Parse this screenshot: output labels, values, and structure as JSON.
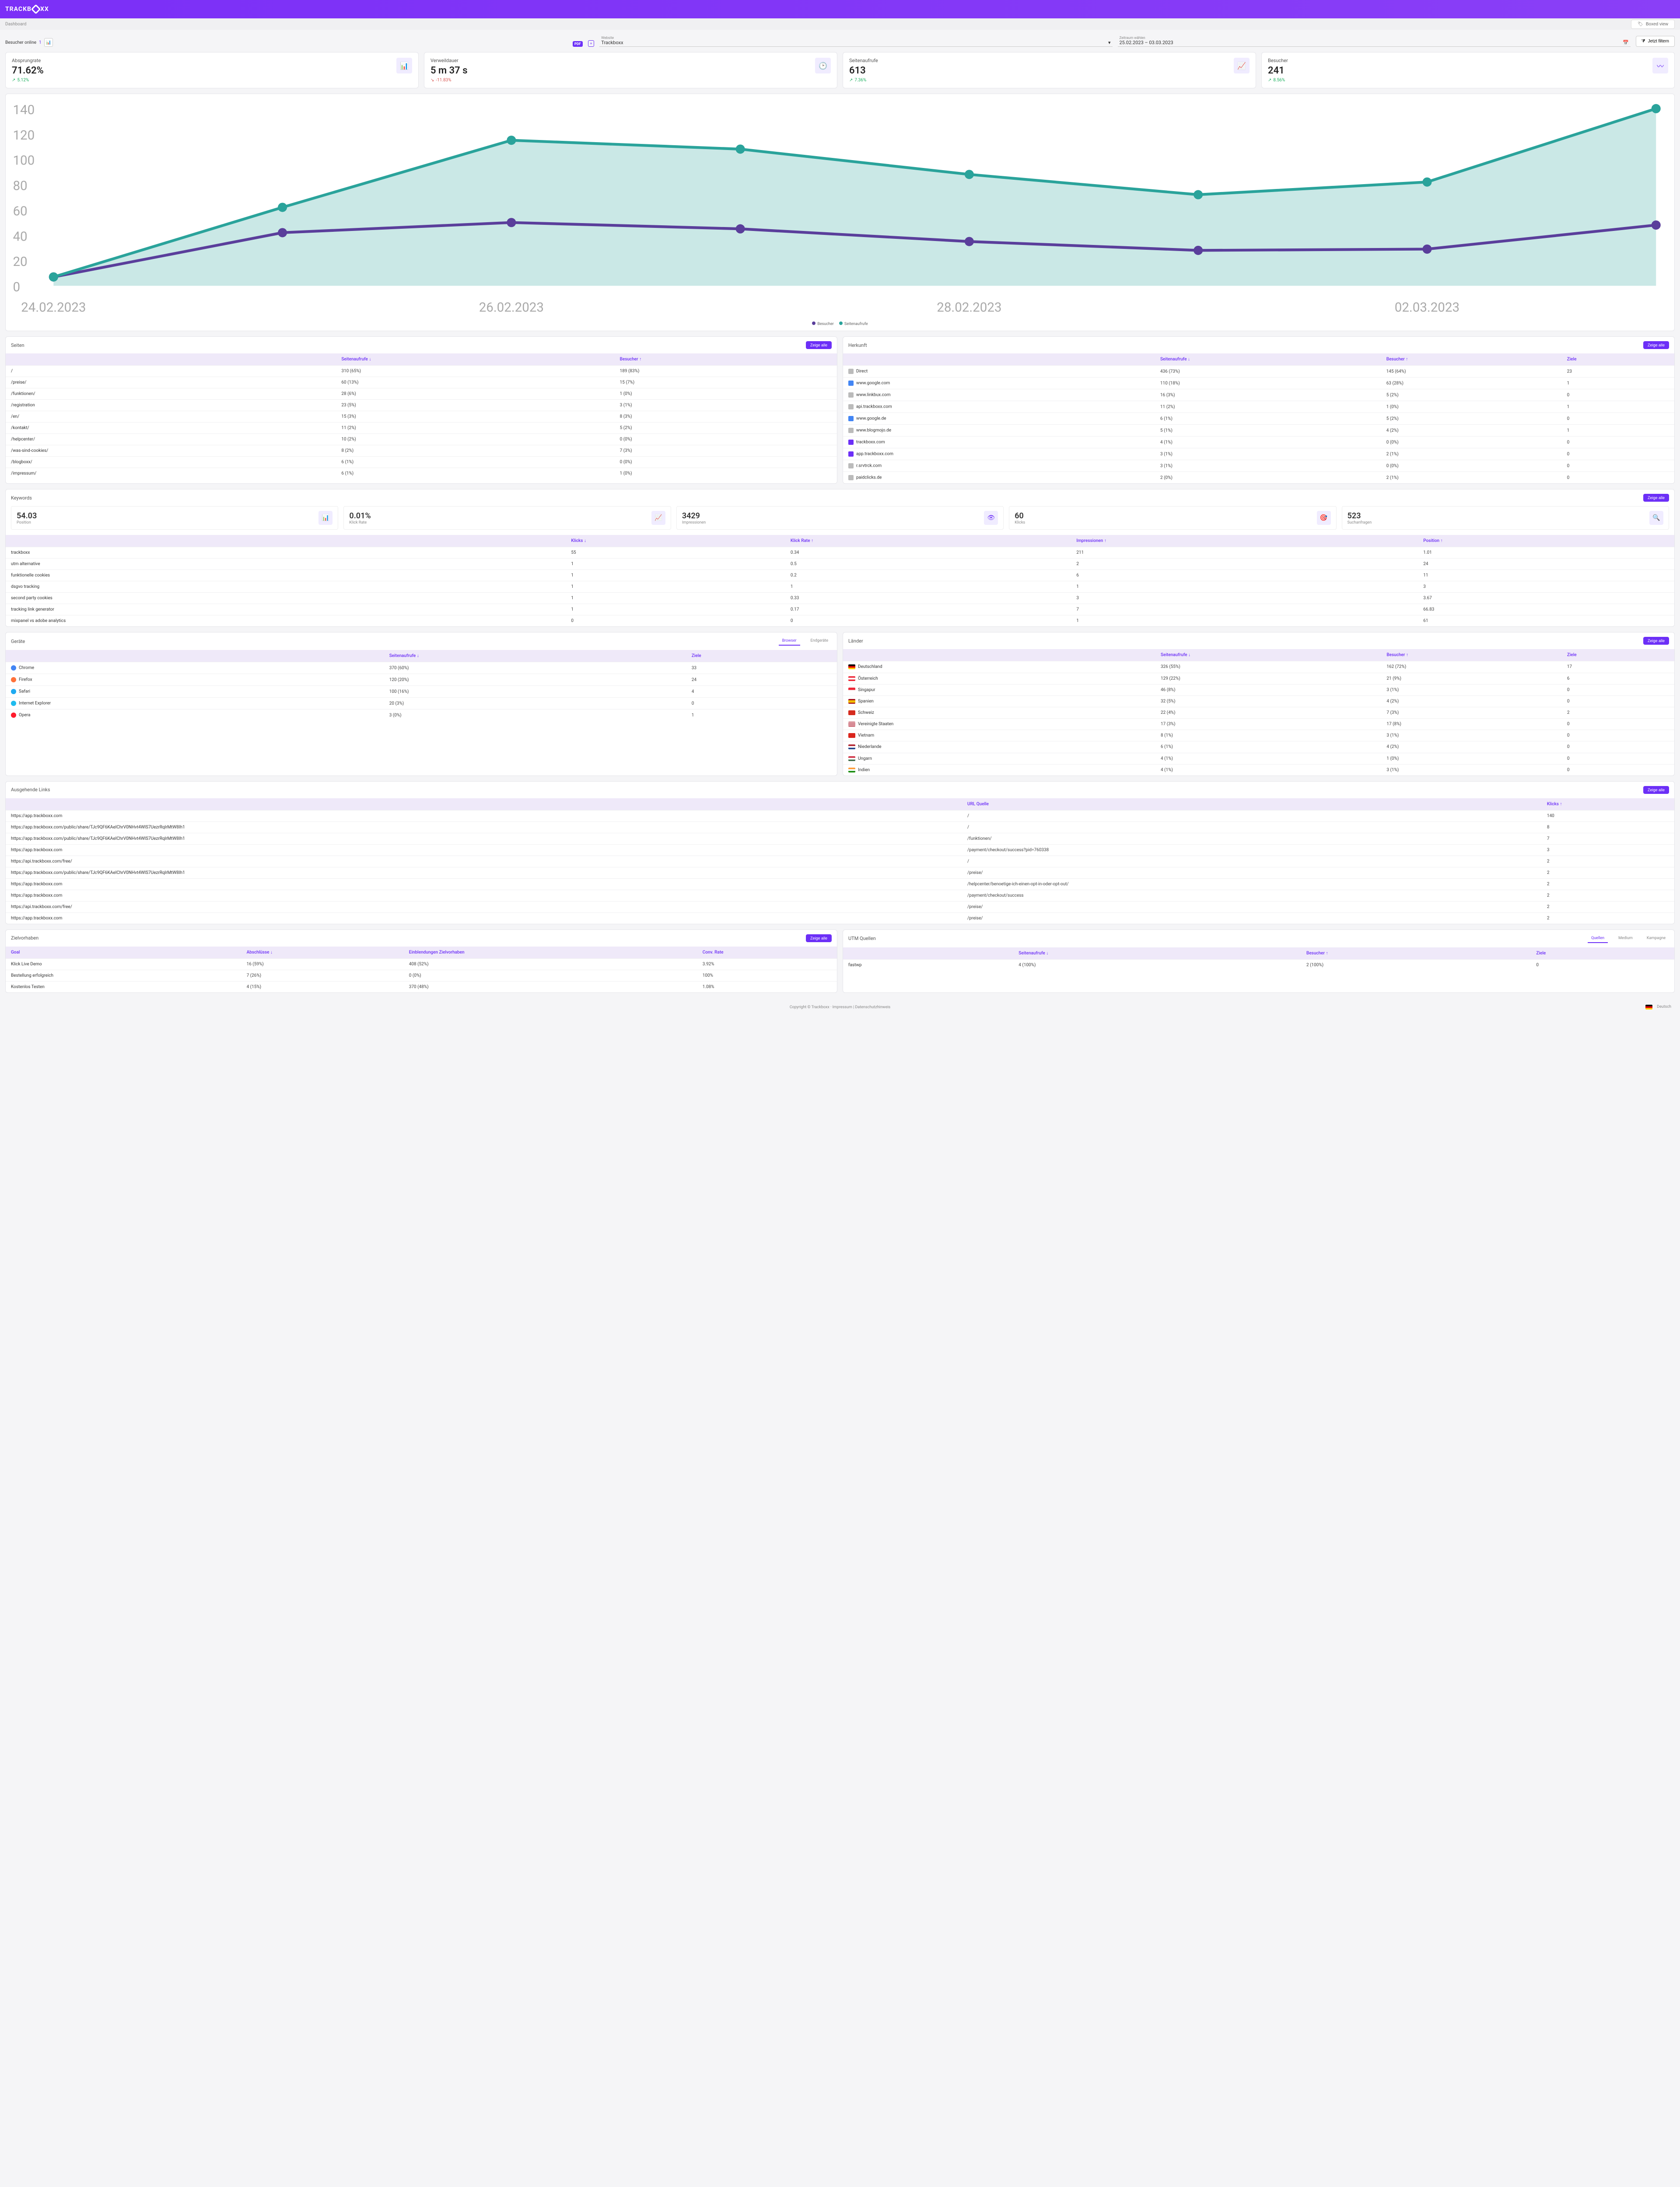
{
  "logo": "TRACKB  XX",
  "breadcrumb": "Dashboard",
  "boxed_view": "Boxed view",
  "visitors_online_label": "Besucher online",
  "visitors_online_value": "1",
  "website_label": "Website",
  "website_value": "Trackboxx",
  "period_label": "Zeitraum wählen",
  "period_value": "25.02.2023 – 03.03.2023",
  "filter_btn": "Jetzt filtern",
  "kpis": [
    {
      "title": "Absprungrate",
      "value": "71.62%",
      "delta": "5.12%",
      "dir": "up",
      "icon": "bar"
    },
    {
      "title": "Verweildauer",
      "value": "5 m 37 s",
      "delta": "-11.83%",
      "dir": "down",
      "icon": "clock"
    },
    {
      "title": "Seitenaufrufe",
      "value": "613",
      "delta": "7.36%",
      "dir": "up",
      "icon": "trend"
    },
    {
      "title": "Besucher",
      "value": "241",
      "delta": "8.56%",
      "dir": "up",
      "icon": "pulse"
    }
  ],
  "chart_data": {
    "type": "area",
    "x": [
      "24.02.2023",
      "25.02.2023",
      "26.02.2023",
      "27.02.2023",
      "28.02.2023",
      "01.03.2023",
      "02.03.2023",
      "03.03.2023"
    ],
    "ylim": [
      0,
      140
    ],
    "yticks": [
      0,
      20,
      40,
      60,
      80,
      100,
      120,
      140
    ],
    "series": [
      {
        "name": "Besucher",
        "color": "#5a3e9b",
        "values": [
          7,
          42,
          50,
          45,
          35,
          28,
          29,
          48
        ]
      },
      {
        "name": "Seitenaufrufe",
        "color": "#2aa39b",
        "values": [
          7,
          62,
          115,
          108,
          88,
          72,
          82,
          140
        ]
      }
    ],
    "x_visible_ticks": [
      "24.02.2023",
      "26.02.2023",
      "28.02.2023",
      "02.03.2023"
    ]
  },
  "show_all": "Zeige alle",
  "pages": {
    "title": "Seiten",
    "cols": [
      "",
      "Seitenaufrufe ↓",
      "Besucher ↑"
    ],
    "rows": [
      [
        "/",
        "310 (65%)",
        "189 (83%)"
      ],
      [
        "/preise/",
        "60 (13%)",
        "15 (7%)"
      ],
      [
        "/funktionen/",
        "28 (6%)",
        "1 (0%)"
      ],
      [
        "/registration",
        "23 (5%)",
        "3 (1%)"
      ],
      [
        "/en/",
        "15 (3%)",
        "8 (3%)"
      ],
      [
        "/kontakt/",
        "11 (2%)",
        "5 (2%)"
      ],
      [
        "/helpcenter/",
        "10 (2%)",
        "0 (0%)"
      ],
      [
        "/was-sind-cookies/",
        "8 (2%)",
        "7 (3%)"
      ],
      [
        "/blogboxx/",
        "6 (1%)",
        "0 (0%)"
      ],
      [
        "/impressum/",
        "6 (1%)",
        "1 (0%)"
      ]
    ]
  },
  "origin": {
    "title": "Herkunft",
    "cols": [
      "",
      "Seitenaufrufe ↓",
      "Besucher ↑",
      "Ziele"
    ],
    "rows": [
      {
        "icon": "link",
        "label": "Direct",
        "v": [
          "436 (73%)",
          "145 (64%)",
          "23"
        ]
      },
      {
        "icon": "google",
        "label": "www.google.com",
        "v": [
          "110 (18%)",
          "63 (28%)",
          "1"
        ]
      },
      {
        "icon": "link",
        "label": "www.linkbux.com",
        "v": [
          "16 (3%)",
          "5 (2%)",
          "0"
        ]
      },
      {
        "icon": "link",
        "label": "api.trackboxx.com",
        "v": [
          "11 (2%)",
          "1 (0%)",
          "1"
        ]
      },
      {
        "icon": "google",
        "label": "www.google.de",
        "v": [
          "6 (1%)",
          "5 (2%)",
          "0"
        ]
      },
      {
        "icon": "link",
        "label": "www.blogmojo.de",
        "v": [
          "5 (1%)",
          "4 (2%)",
          "1"
        ]
      },
      {
        "icon": "tb",
        "label": "trackboxx.com",
        "v": [
          "4 (1%)",
          "0 (0%)",
          "0"
        ]
      },
      {
        "icon": "tb",
        "label": "app.trackboxx.com",
        "v": [
          "3 (1%)",
          "2 (1%)",
          "0"
        ]
      },
      {
        "icon": "link",
        "label": "r.srvtrck.com",
        "v": [
          "3 (1%)",
          "0 (0%)",
          "0"
        ]
      },
      {
        "icon": "link",
        "label": "paidclicks.de",
        "v": [
          "2 (0%)",
          "2 (1%)",
          "0"
        ]
      }
    ]
  },
  "keywords": {
    "title": "Keywords",
    "stats": [
      {
        "value": "54.03",
        "label": "Position",
        "icon": "bars"
      },
      {
        "value": "0.01%",
        "label": "Klick Rate",
        "icon": "trend"
      },
      {
        "value": "3429",
        "label": "Impressionen",
        "icon": "eye"
      },
      {
        "value": "60",
        "label": "Klicks",
        "icon": "target"
      },
      {
        "value": "523",
        "label": "Suchanfragen",
        "icon": "search"
      }
    ],
    "cols": [
      "",
      "Klicks ↓",
      "Klick Rate ↑",
      "Impressionen ↑",
      "Position ↑"
    ],
    "rows": [
      [
        "trackboxx",
        "55",
        "0.34",
        "211",
        "1.01"
      ],
      [
        "utm alternative",
        "1",
        "0.5",
        "2",
        "24"
      ],
      [
        "funktionelle cookies",
        "1",
        "0.2",
        "6",
        "11"
      ],
      [
        "dsgvo tracking",
        "1",
        "1",
        "1",
        "3"
      ],
      [
        "second party cookies",
        "1",
        "0.33",
        "3",
        "3.67"
      ],
      [
        "tracking link generator",
        "1",
        "0.17",
        "7",
        "66.83"
      ],
      [
        "mixpanel vs adobe analytics",
        "0",
        "0",
        "1",
        "61"
      ]
    ]
  },
  "devices": {
    "title": "Geräte",
    "tabs": [
      "Browser",
      "Endgeräte"
    ],
    "cols": [
      "",
      "Seitenaufrufe ↓",
      "Ziele"
    ],
    "rows": [
      {
        "icon": "chrome",
        "label": "Chrome",
        "v": [
          "370 (60%)",
          "33"
        ]
      },
      {
        "icon": "firefox",
        "label": "Firefox",
        "v": [
          "120 (20%)",
          "24"
        ]
      },
      {
        "icon": "safari",
        "label": "Safari",
        "v": [
          "100 (16%)",
          "4"
        ]
      },
      {
        "icon": "ie",
        "label": "Internet Explorer",
        "v": [
          "20 (3%)",
          "0"
        ]
      },
      {
        "icon": "opera",
        "label": "Opera",
        "v": [
          "3 (0%)",
          "1"
        ]
      }
    ]
  },
  "countries": {
    "title": "Länder",
    "cols": [
      "",
      "Seitenaufrufe ↓",
      "Besucher ↑",
      "Ziele"
    ],
    "rows": [
      {
        "flag": "de",
        "label": "Deutschland",
        "v": [
          "326 (55%)",
          "162 (72%)",
          "17"
        ]
      },
      {
        "flag": "at",
        "label": "Österreich",
        "v": [
          "129 (22%)",
          "21 (9%)",
          "6"
        ]
      },
      {
        "flag": "sg",
        "label": "Singapur",
        "v": [
          "46 (8%)",
          "3 (1%)",
          "0"
        ]
      },
      {
        "flag": "es",
        "label": "Spanien",
        "v": [
          "32 (5%)",
          "4 (2%)",
          "0"
        ]
      },
      {
        "flag": "ch",
        "label": "Schweiz",
        "v": [
          "22 (4%)",
          "7 (3%)",
          "2"
        ]
      },
      {
        "flag": "us",
        "label": "Vereinigte Staaten",
        "v": [
          "17 (3%)",
          "17 (8%)",
          "0"
        ]
      },
      {
        "flag": "vn",
        "label": "Vietnam",
        "v": [
          "8 (1%)",
          "3 (1%)",
          "0"
        ]
      },
      {
        "flag": "nl",
        "label": "Niederlande",
        "v": [
          "6 (1%)",
          "4 (2%)",
          "0"
        ]
      },
      {
        "flag": "hu",
        "label": "Ungarn",
        "v": [
          "4 (1%)",
          "1 (0%)",
          "0"
        ]
      },
      {
        "flag": "in",
        "label": "Indien",
        "v": [
          "4 (1%)",
          "3 (1%)",
          "0"
        ]
      }
    ]
  },
  "outgoing": {
    "title": "Ausgehende Links",
    "cols": [
      "",
      "URL Quelle",
      "Klicks ↑"
    ],
    "rows": [
      [
        "https://app.trackboxx.com",
        "/",
        "140"
      ],
      [
        "https://app.trackboxx.com/public/share/TJc9QF6KAeIChrV0NHvt4WlS7UezrRqlrMtW8Ih1",
        "/",
        "8"
      ],
      [
        "https://app.trackboxx.com/public/share/TJc9QF6KAeIChrV0NHvt4WlS7UezrRqlrMtW8Ih1",
        "/funktionen/",
        "7"
      ],
      [
        "https://app.trackboxx.com",
        "/payment/checkout/success?pid=760338",
        "3"
      ],
      [
        "https://api.trackboxx.com/free/",
        "/",
        "2"
      ],
      [
        "https://app.trackboxx.com/public/share/TJc9QF6KAeIChrV0NHvt4WlS7UezrRqlrMtW8Ih1",
        "/preise/",
        "2"
      ],
      [
        "https://app.trackboxx.com",
        "/helpcenter/benoetige-ich-einen-opt-in-oder-opt-out/",
        "2"
      ],
      [
        "https://app.trackboxx.com",
        "/payment/checkout/success",
        "2"
      ],
      [
        "https://api.trackboxx.com/free/",
        "/preise/",
        "2"
      ],
      [
        "https://app.trackboxx.com",
        "/preise/",
        "2"
      ]
    ]
  },
  "goals": {
    "title": "Zielvorhaben",
    "cols": [
      "Goal",
      "Abschlüsse ↓",
      "Einblendungen Zielvorhaben",
      "Conv. Rate"
    ],
    "rows": [
      [
        "Klick Live Demo",
        "16 (59%)",
        "408 (52%)",
        "3.92%"
      ],
      [
        "Bestellung erfolgreich",
        "7 (26%)",
        "0 (0%)",
        "100%"
      ],
      [
        "Kostenlos Testen",
        "4 (15%)",
        "370 (48%)",
        "1.08%"
      ]
    ]
  },
  "utm": {
    "title": "UTM Quellen",
    "tabs": [
      "Quellen",
      "Medium",
      "Kampagne"
    ],
    "cols": [
      "",
      "Seitenaufrufe ↓",
      "Besucher ↑",
      "Ziele"
    ],
    "rows": [
      [
        "fastwp",
        "4 (100%)",
        "2 (100%)",
        "0"
      ]
    ]
  },
  "footer": {
    "copyright": "Copyright © Trackboxx",
    "imprint": "Impressum",
    "privacy": "Datenschutzhinweis",
    "lang": "Deutsch"
  }
}
